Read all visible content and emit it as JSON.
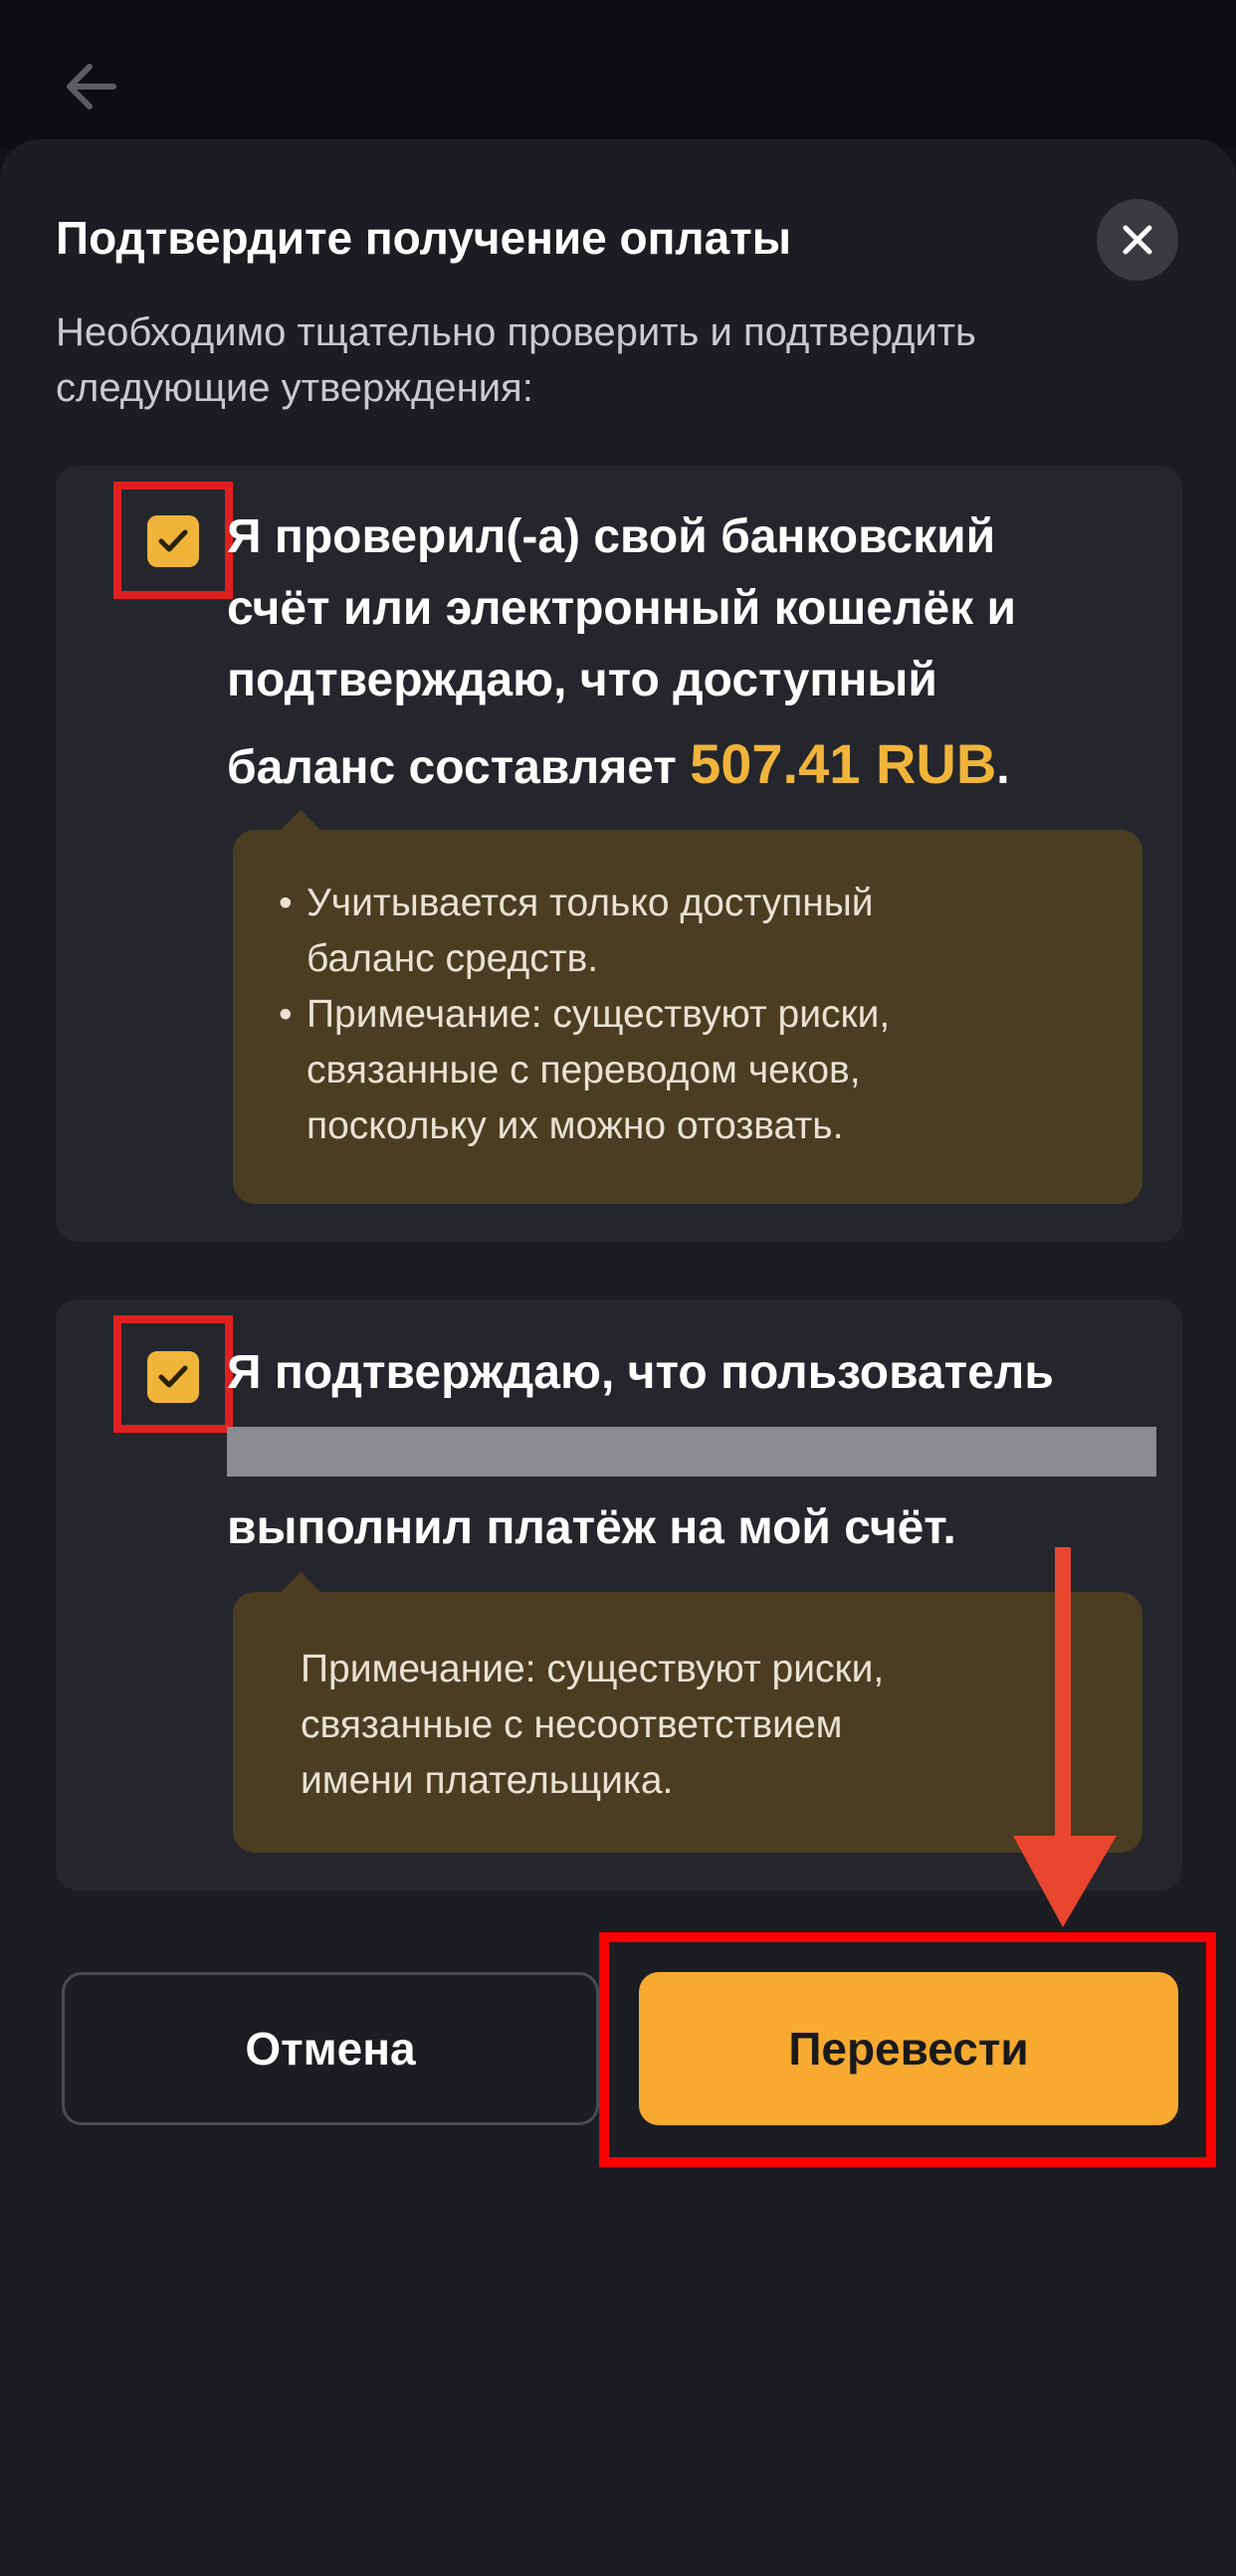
{
  "header": {
    "back_icon": "arrow-left-icon"
  },
  "dialog": {
    "title": "Подтвердите получение оплаты",
    "close_icon": "close-icon",
    "intro_line1": "Необходимо тщательно проверить и подтвердить",
    "intro_line2": "следующие утверждения:"
  },
  "statement1": {
    "checked": true,
    "text_line1": "Я проверил(-а) свой банковский",
    "text_line2": "счёт или электронный кошелёк и",
    "text_line3": "подтверждаю, что доступный",
    "text_line4": "баланс составляет",
    "amount": "507.41 RUB",
    "period": ".",
    "note_items": [
      {
        "line1": "Учитывается только доступный",
        "line2": "баланс средств."
      },
      {
        "line1": "Примечание: существуют риски,",
        "line2": "связанные с переводом чеков,",
        "line3": "поскольку их можно отозвать."
      }
    ]
  },
  "statement2": {
    "checked": true,
    "text_line1": "Я подтверждаю, что пользователь",
    "text_line3": "выполнил платёж на мой счёт.",
    "note_line1": "Примечание: существуют риски,",
    "note_line2": "связанные с несоответствием",
    "note_line3": "имени плательщика."
  },
  "buttons": {
    "cancel_label": "Отмена",
    "confirm_label": "Перевести"
  },
  "colors": {
    "accent": "#f0b43a",
    "confirm_button": "#f7a930",
    "highlight_frame": "#ff0000",
    "note_background": "#4a3d22",
    "background": "#1c1d22"
  }
}
